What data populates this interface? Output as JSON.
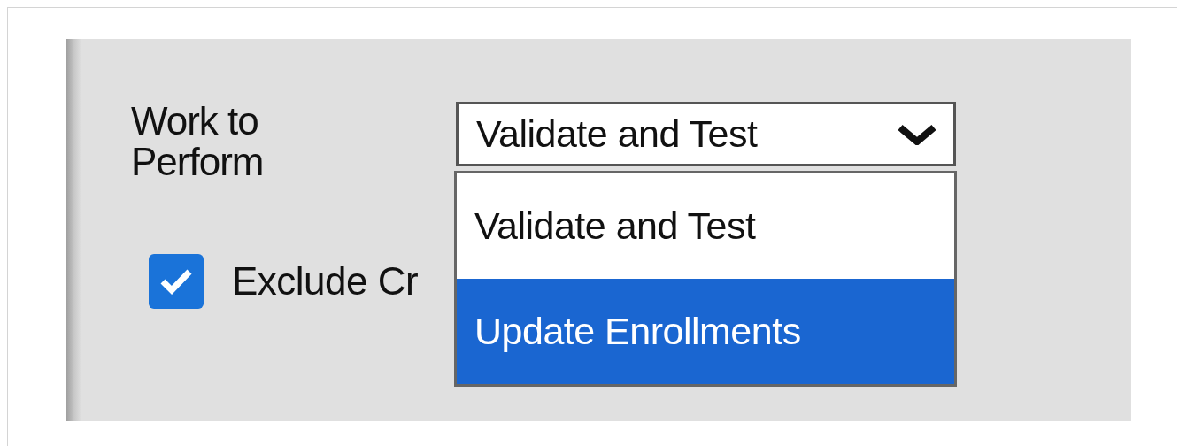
{
  "field": {
    "label": "Work to Perform",
    "value": "Validate and Test",
    "expanded": true
  },
  "options": [
    {
      "label": "Validate and Test",
      "selected": false
    },
    {
      "label": "Update Enrollments",
      "selected": true
    }
  ],
  "checkbox": {
    "label": "Exclude Cr",
    "checked": true
  }
}
